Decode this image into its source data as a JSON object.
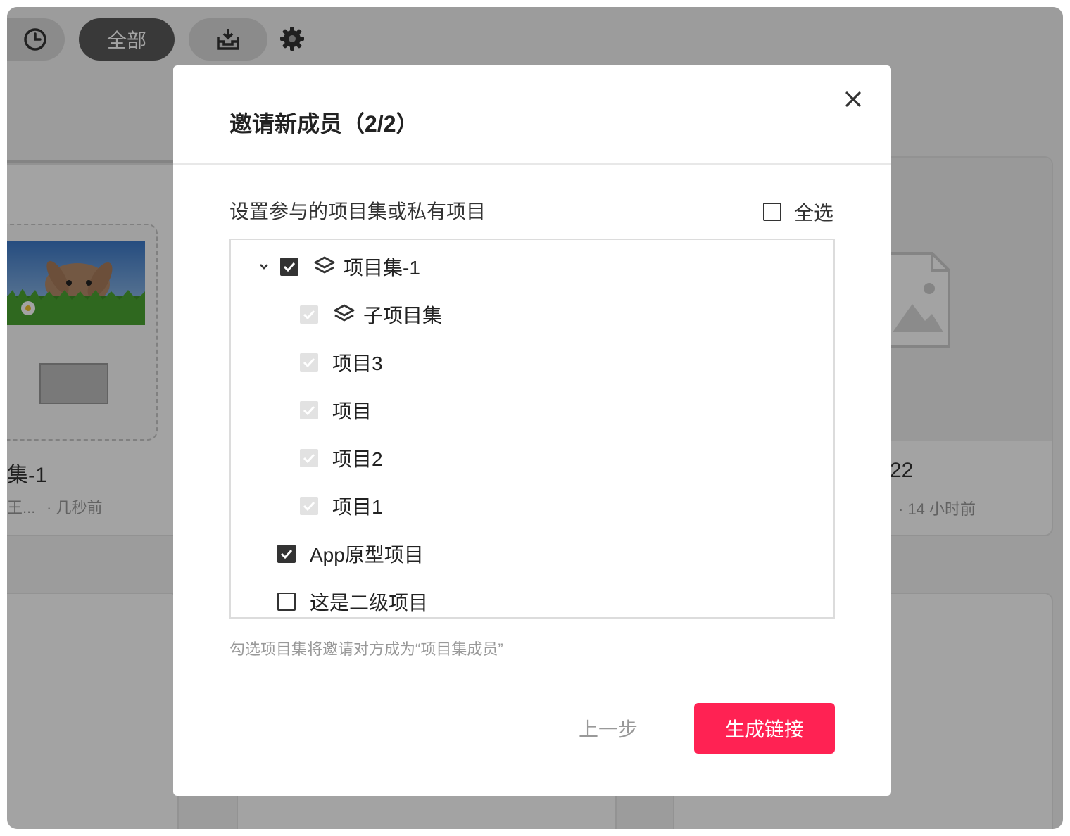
{
  "toolbar": {
    "history_icon": "clock-icon",
    "all_label": "全部",
    "import_icon": "import-tray-icon",
    "settings_icon": "gear-icon"
  },
  "background": {
    "left_card": {
      "title": "集-1",
      "meta_left": "王...",
      "meta_right": "· 几秒前"
    },
    "right_card": {
      "title": "22",
      "meta_right": "· 14 小时前"
    }
  },
  "modal": {
    "title": "邀请新成员（2/2）",
    "close_icon": "close-icon",
    "section_label": "设置参与的项目集或私有项目",
    "select_all_label": "全选",
    "tree": [
      {
        "label": "项目集-1",
        "state": "checked",
        "icon": "layers-icon",
        "level": 0,
        "expanded": true
      },
      {
        "label": "子项目集",
        "state": "disabled-checked",
        "icon": "layers-icon",
        "level": 1
      },
      {
        "label": "项目3",
        "state": "disabled-checked",
        "level": 1
      },
      {
        "label": "项目",
        "state": "disabled-checked",
        "level": 1
      },
      {
        "label": "项目2",
        "state": "disabled-checked",
        "level": 1
      },
      {
        "label": "项目1",
        "state": "disabled-checked",
        "level": 1
      },
      {
        "label": "App原型项目",
        "state": "checked",
        "level": 0
      },
      {
        "label": "这是二级项目",
        "state": "unchecked",
        "level": 0
      }
    ],
    "hint": "勾选项目集将邀请对方成为“项目集成员”",
    "prev_label": "上一步",
    "generate_label": "生成链接"
  },
  "colors": {
    "primary": "#ff2253",
    "overlay": "rgba(0,0,0,0.36)"
  }
}
